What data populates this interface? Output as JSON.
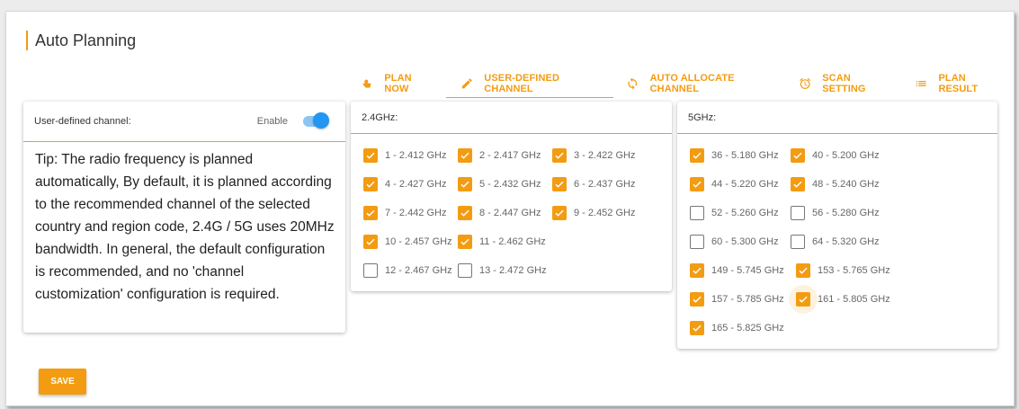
{
  "page": {
    "title": "Auto Planning"
  },
  "tabs": [
    {
      "label": "PLAN NOW",
      "icon": "touch-icon",
      "active": false
    },
    {
      "label": "USER-DEFINED CHANNEL",
      "icon": "pencil-icon",
      "active": true
    },
    {
      "label": "AUTO ALLOCATE CHANNEL",
      "icon": "sync-icon",
      "active": false
    },
    {
      "label": "SCAN SETTING",
      "icon": "alarm-clock-icon",
      "active": false
    },
    {
      "label": "PLAN RESULT",
      "icon": "list-icon",
      "active": false
    }
  ],
  "user_defined": {
    "label": "User-defined channel:",
    "enable_label": "Enable",
    "enabled": true,
    "tip": "Tip: The radio frequency is planned automatically, By default, it is planned according to the recommended channel of the selected country and region code, 2.4G / 5G uses 20MHz bandwidth. In general, the default configuration is recommended, and no 'channel customization' configuration is required."
  },
  "band_24": {
    "label": "2.4GHz:",
    "rows": [
      [
        {
          "label": "1 - 2.412 GHz",
          "checked": true
        },
        {
          "label": "2 - 2.417 GHz",
          "checked": true
        },
        {
          "label": "3 - 2.422 GHz",
          "checked": true
        }
      ],
      [
        {
          "label": "4 - 2.427 GHz",
          "checked": true
        },
        {
          "label": "5 - 2.432 GHz",
          "checked": true
        },
        {
          "label": "6 - 2.437 GHz",
          "checked": true
        }
      ],
      [
        {
          "label": "7 - 2.442 GHz",
          "checked": true
        },
        {
          "label": "8 - 2.447 GHz",
          "checked": true
        },
        {
          "label": "9 - 2.452 GHz",
          "checked": true
        }
      ],
      [
        {
          "label": "10 - 2.457 GHz",
          "checked": true
        },
        {
          "label": "11 - 2.462 GHz",
          "checked": true
        }
      ],
      [
        {
          "label": "12 - 2.467 GHz",
          "checked": false
        },
        {
          "label": "13 - 2.472 GHz",
          "checked": false
        }
      ]
    ]
  },
  "band_5": {
    "label": "5GHz:",
    "rows": [
      [
        {
          "label": "36 - 5.180 GHz",
          "checked": true
        },
        {
          "label": "40 - 5.200 GHz",
          "checked": true
        }
      ],
      [
        {
          "label": "44 - 5.220 GHz",
          "checked": true
        },
        {
          "label": "48 - 5.240 GHz",
          "checked": true
        }
      ],
      [
        {
          "label": "52 - 5.260 GHz",
          "checked": false
        },
        {
          "label": "56 - 5.280 GHz",
          "checked": false
        }
      ],
      [
        {
          "label": "60 - 5.300 GHz",
          "checked": false
        },
        {
          "label": "64 - 5.320 GHz",
          "checked": false
        }
      ],
      [
        {
          "label": "149 - 5.745 GHz",
          "checked": true
        },
        {
          "label": "153 - 5.765 GHz",
          "checked": true
        }
      ],
      [
        {
          "label": "157 - 5.785 GHz",
          "checked": true
        },
        {
          "label": "161 - 5.805 GHz",
          "checked": true,
          "focused": true
        }
      ],
      [
        {
          "label": "165 - 5.825 GHz",
          "checked": true
        }
      ]
    ]
  },
  "actions": {
    "save_label": "SAVE"
  },
  "colors": {
    "accent": "#f39c12",
    "toggle": "#2196f3"
  }
}
